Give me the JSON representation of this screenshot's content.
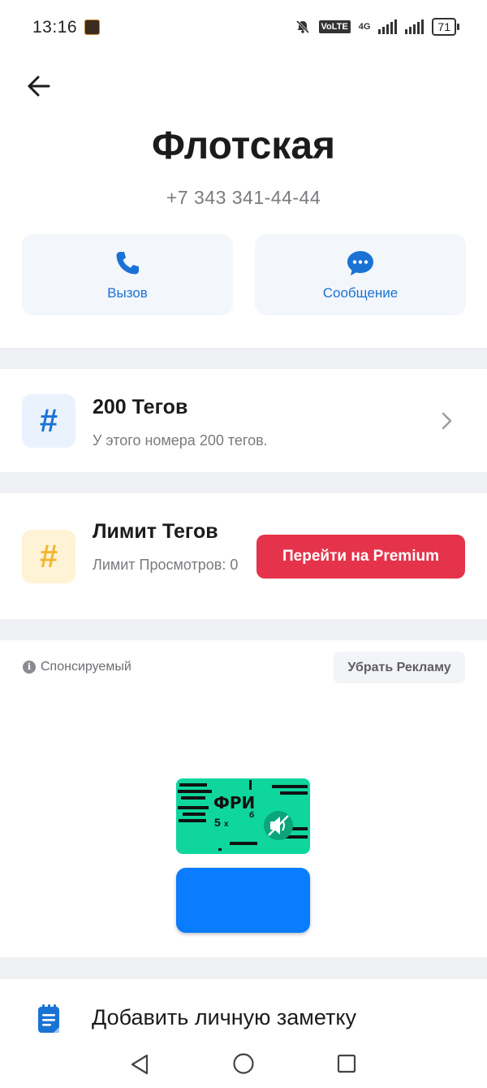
{
  "status_bar": {
    "time": "13:16",
    "volte": "VoLTE",
    "network": "4G",
    "battery": "71",
    "icons": [
      "mute-bell-icon",
      "signal-icon",
      "signal-icon",
      "battery-icon"
    ]
  },
  "header": {
    "back_icon": "arrow-left-icon",
    "title": "Флотская",
    "phone": "+7 343 341-44-44"
  },
  "actions": [
    {
      "label": "Вызов",
      "icon": "phone-icon"
    },
    {
      "label": "Сообщение",
      "icon": "chat-bubble-icon"
    }
  ],
  "tags_row": {
    "title": "200 Тегов",
    "subtitle": "У этого номера 200 тегов.",
    "icon": "hash-icon"
  },
  "limit_row": {
    "title": "Лимит Тегов",
    "subtitle": "Лимит Просмотров: 0",
    "button": "Перейти на Premium",
    "icon": "hash-icon"
  },
  "ad": {
    "sponsored_label": "Спонсируемый",
    "remove_ad_label": "Убрать Рекламу",
    "banner_text": "ФРИ",
    "banner_small_1": "5",
    "banner_small_2": "х",
    "banner_small_3": "б"
  },
  "note": {
    "label": "Добавить личную заметку",
    "icon": "note-icon"
  },
  "colors": {
    "accent_blue": "#1a73d4",
    "premium_red": "#e5334b",
    "ad_green": "#0fd69d",
    "ad_blue": "#0a7cff"
  }
}
